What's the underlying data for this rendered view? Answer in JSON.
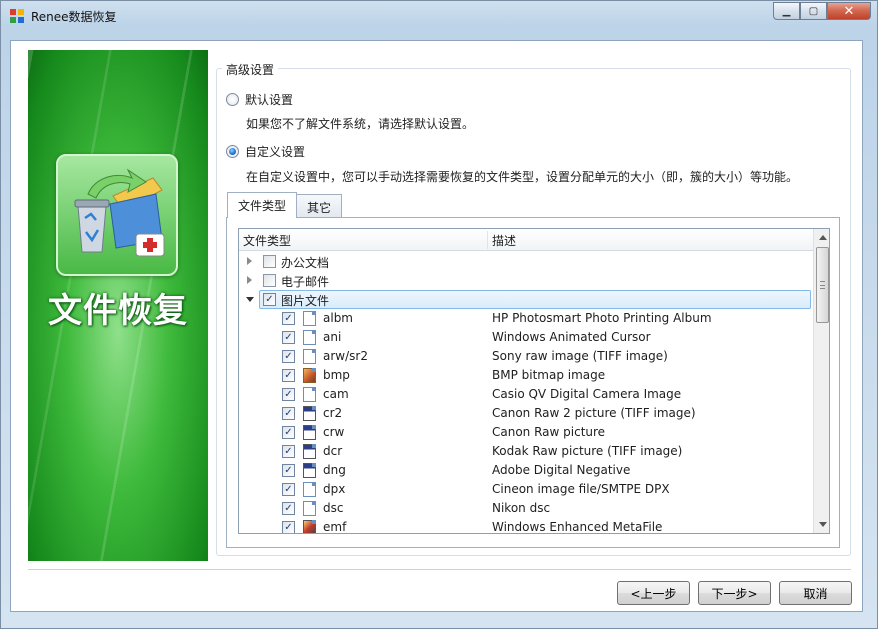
{
  "window": {
    "title": "Renee数据恢复",
    "buttons": {
      "minimize": "▁",
      "maximize": "▢",
      "close": "✕"
    }
  },
  "banner": {
    "title": "文件恢复"
  },
  "advanced": {
    "legend": "高级设置",
    "default_option": {
      "label": "默认设置",
      "description": "如果您不了解文件系统，请选择默认设置。",
      "selected": false
    },
    "custom_option": {
      "label": "自定义设置",
      "description": "在自定义设置中，您可以手动选择需要恢复的文件类型，设置分配单元的大小（即，簇的大小）等功能。",
      "selected": true
    }
  },
  "tabs": [
    {
      "label": "文件类型",
      "active": true
    },
    {
      "label": "其它",
      "active": false
    }
  ],
  "file_list": {
    "columns": {
      "type": "文件类型",
      "description": "描述"
    },
    "categories": [
      {
        "label": "办公文档",
        "expanded": false,
        "checked": false
      },
      {
        "label": "电子邮件",
        "expanded": false,
        "checked": false
      },
      {
        "label": "图片文件",
        "expanded": true,
        "checked": true
      }
    ],
    "items": [
      {
        "ext": "albm",
        "description": "HP Photosmart Photo Printing Album",
        "icon": "doc-icon",
        "checked": true
      },
      {
        "ext": "ani",
        "description": "Windows Animated Cursor",
        "icon": "doc-icon",
        "checked": true
      },
      {
        "ext": "arw/sr2",
        "description": "Sony raw image (TIFF image)",
        "icon": "doc-icon",
        "checked": true
      },
      {
        "ext": "bmp",
        "description": "BMP bitmap image",
        "icon": "bitmap-icon",
        "checked": true
      },
      {
        "ext": "cam",
        "description": "Casio QV Digital Camera Image",
        "icon": "doc-icon",
        "checked": true
      },
      {
        "ext": "cr2",
        "description": "Canon Raw 2 picture (TIFF image)",
        "icon": "raw-image-icon",
        "checked": true
      },
      {
        "ext": "crw",
        "description": "Canon Raw picture",
        "icon": "raw-image-icon",
        "checked": true
      },
      {
        "ext": "dcr",
        "description": "Kodak Raw picture (TIFF image)",
        "icon": "raw-image-icon",
        "checked": true
      },
      {
        "ext": "dng",
        "description": "Adobe Digital Negative",
        "icon": "raw-image-icon",
        "checked": true
      },
      {
        "ext": "dpx",
        "description": "Cineon image file/SMTPE DPX",
        "icon": "doc-icon",
        "checked": true
      },
      {
        "ext": "dsc",
        "description": "Nikon dsc",
        "icon": "doc-icon",
        "checked": true
      },
      {
        "ext": "emf",
        "description": "Windows Enhanced MetaFile",
        "icon": "metafile-icon",
        "checked": true
      }
    ]
  },
  "footer": {
    "prev": "<上一步",
    "next": "下一步>",
    "cancel": "取消"
  }
}
